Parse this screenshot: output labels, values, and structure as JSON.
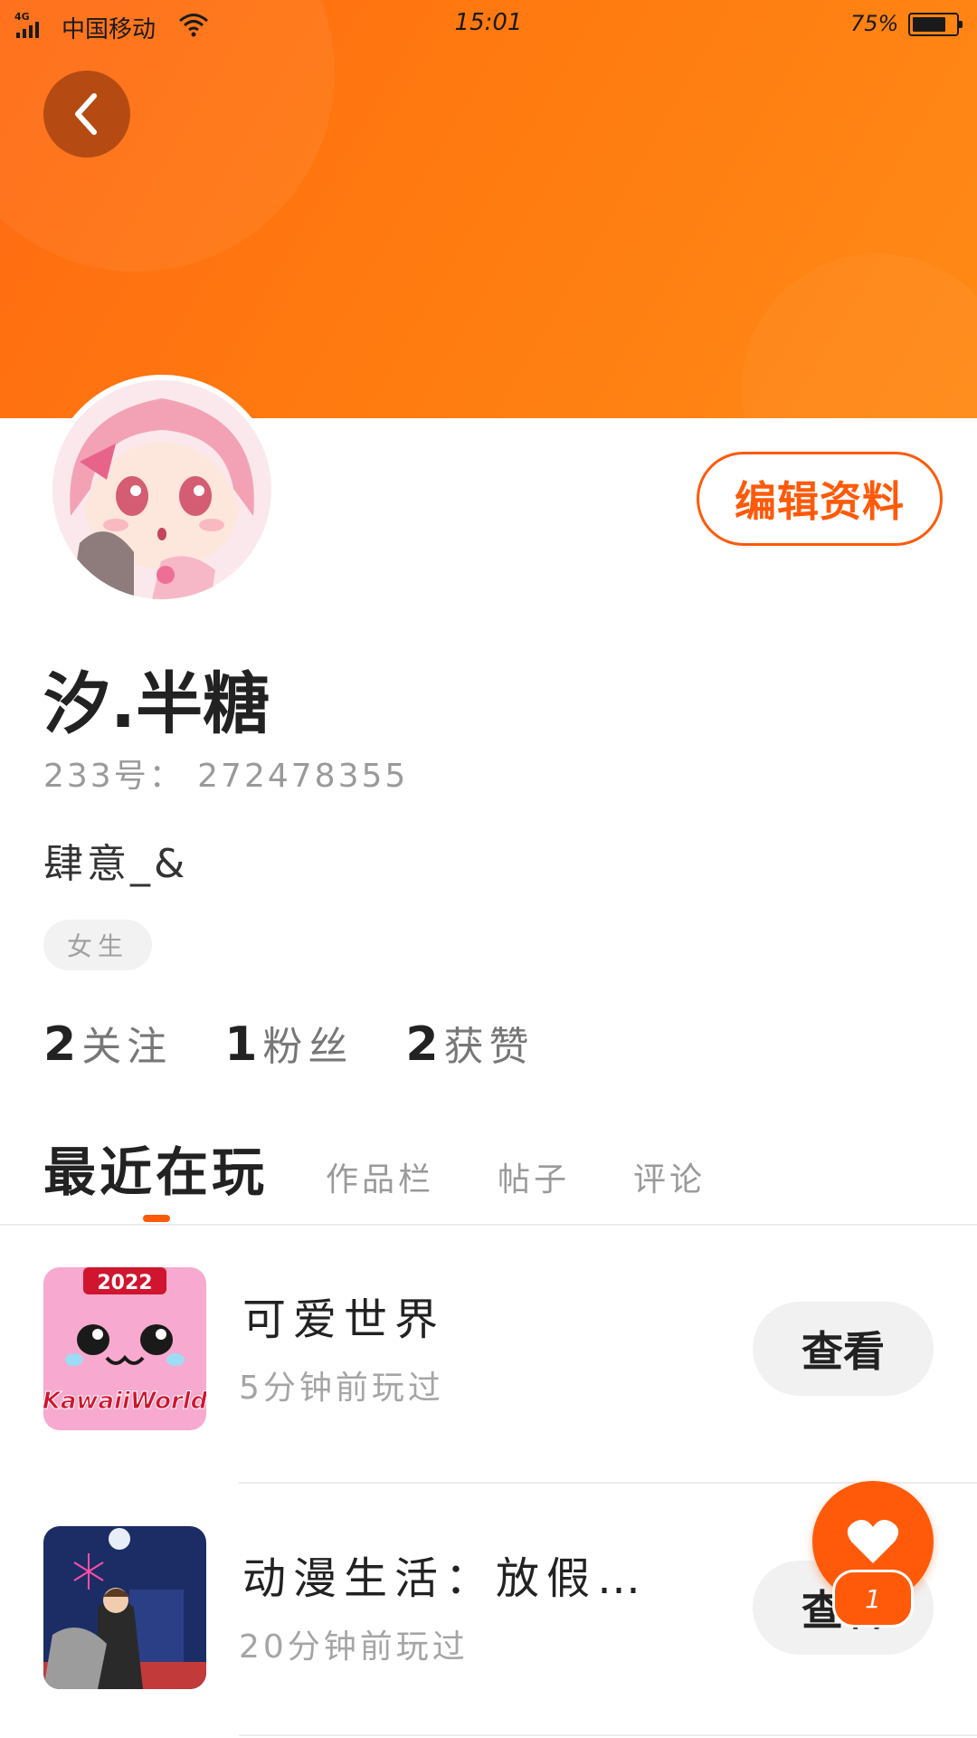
{
  "status_bar": {
    "network": "4G",
    "carrier": "中国移动",
    "time": "15:01",
    "battery_percent": "75%",
    "battery_level": 0.75
  },
  "header": {
    "back_icon": "chevron-left-icon",
    "gradient_colors": [
      "#ff6a12",
      "#ff8a16"
    ]
  },
  "profile": {
    "avatar": "anime-girl-avatar",
    "edit_label": "编辑资料",
    "name": "汐.半糖",
    "id_text": "233号： 272478355",
    "signature": "肆意_&",
    "gender_tag": "女生",
    "stats": [
      {
        "num": "2",
        "label": "关注"
      },
      {
        "num": "1",
        "label": "粉丝"
      },
      {
        "num": "2",
        "label": "获赞"
      }
    ]
  },
  "tabs": [
    {
      "label": "最近在玩",
      "active": true
    },
    {
      "label": "作品栏",
      "active": false
    },
    {
      "label": "帖子",
      "active": false
    },
    {
      "label": "评论",
      "active": false
    }
  ],
  "games": [
    {
      "title": "可爱世界",
      "time": "5分钟前玩过",
      "button": "查看",
      "icon": "kawaii-world-icon",
      "icon_text": "KawaiiWorld",
      "icon_year": "2022"
    },
    {
      "title": "动漫生活：放假…",
      "time": "20分钟前玩过",
      "button": "查看",
      "icon": "anime-life-icon"
    }
  ],
  "like_fab": {
    "icon": "heart-icon",
    "badge": "1"
  },
  "accent_color": "#ff5a0a"
}
